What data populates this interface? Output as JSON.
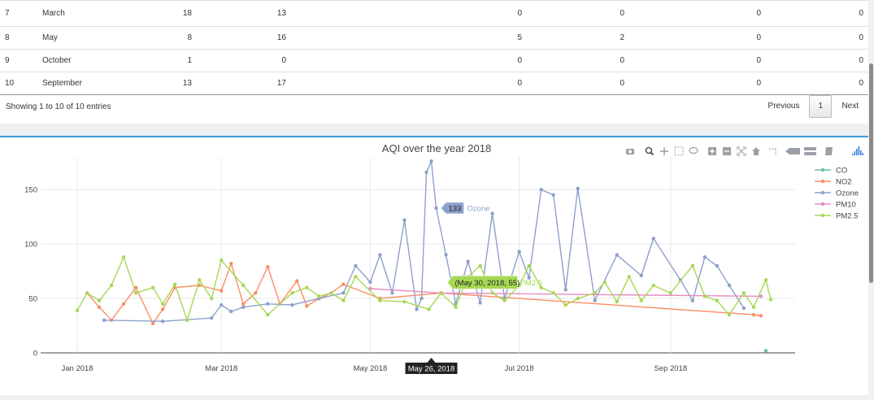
{
  "table": {
    "rows": [
      [
        "7",
        "March",
        "18",
        "13",
        "0",
        "0",
        "0",
        "0"
      ],
      [
        "8",
        "May",
        "8",
        "16",
        "5",
        "2",
        "0",
        "0"
      ],
      [
        "9",
        "October",
        "1",
        "0",
        "0",
        "0",
        "0",
        "0"
      ],
      [
        "10",
        "September",
        "13",
        "17",
        "0",
        "0",
        "0",
        "0"
      ]
    ],
    "info": "Showing 1 to 10 of 10 entries",
    "pagination": {
      "previous": "Previous",
      "current": "1",
      "next": "Next"
    }
  },
  "chart_data": {
    "type": "line",
    "title": "AQI over the year 2018",
    "x_ticks": [
      "Jan 2018",
      "Mar 2018",
      "May 2018",
      "Jul 2018",
      "Sep 2018"
    ],
    "y_ticks": [
      0,
      50,
      100,
      150
    ],
    "ylim": [
      0,
      180
    ],
    "xlim": [
      "2017-12-17",
      "2018-10-22"
    ],
    "grid": true,
    "legend": "right",
    "series": [
      {
        "name": "CO",
        "color": "#66c2a5",
        "x": [
          "2018-10-10"
        ],
        "y": [
          2
        ]
      },
      {
        "name": "NO2",
        "color": "#fc8d62",
        "x": [
          "2018-01-05",
          "2018-01-10",
          "2018-01-15",
          "2018-01-20",
          "2018-01-25",
          "2018-02-01",
          "2018-02-05",
          "2018-02-10",
          "2018-02-20",
          "2018-03-01",
          "2018-03-05",
          "2018-03-10",
          "2018-03-15",
          "2018-03-20",
          "2018-03-25",
          "2018-04-01",
          "2018-04-05",
          "2018-04-10",
          "2018-04-15",
          "2018-04-20",
          "2018-05-05",
          "2018-05-30",
          "2018-10-05",
          "2018-10-08"
        ],
        "y": [
          55,
          42,
          30,
          45,
          60,
          27,
          40,
          60,
          62,
          57,
          82,
          45,
          55,
          79,
          45,
          66,
          43,
          50,
          55,
          63,
          50,
          55,
          35,
          34
        ]
      },
      {
        "name": "Ozone",
        "color": "#8da0cb",
        "x": [
          "2018-01-12",
          "2018-02-05",
          "2018-02-25",
          "2018-03-01",
          "2018-03-05",
          "2018-03-10",
          "2018-03-20",
          "2018-03-30",
          "2018-04-10",
          "2018-04-20",
          "2018-04-25",
          "2018-05-01",
          "2018-05-05",
          "2018-05-10",
          "2018-05-15",
          "2018-05-20",
          "2018-05-22",
          "2018-05-24",
          "2018-05-26",
          "2018-05-28",
          "2018-06-01",
          "2018-06-05",
          "2018-06-10",
          "2018-06-15",
          "2018-06-20",
          "2018-06-25",
          "2018-07-01",
          "2018-07-05",
          "2018-07-10",
          "2018-07-15",
          "2018-07-20",
          "2018-07-25",
          "2018-08-01",
          "2018-08-10",
          "2018-08-20",
          "2018-08-25",
          "2018-09-05",
          "2018-09-10",
          "2018-09-15",
          "2018-09-20",
          "2018-09-25",
          "2018-10-01"
        ],
        "y": [
          30,
          29,
          32,
          44,
          38,
          42,
          45,
          44,
          50,
          55,
          80,
          65,
          90,
          55,
          122,
          40,
          50,
          166,
          176,
          133,
          90,
          45,
          84,
          46,
          128,
          50,
          93,
          69,
          150,
          145,
          58,
          151,
          48,
          90,
          71,
          105,
          67,
          48,
          88,
          80,
          62,
          41
        ]
      },
      {
        "name": "PM10",
        "color": "#e78ac3",
        "x": [
          "2018-05-01",
          "2018-05-30",
          "2018-10-08"
        ],
        "y": [
          59,
          55,
          52
        ]
      },
      {
        "name": "PM2.5",
        "color": "#a6d854",
        "x": [
          "2018-01-01",
          "2018-01-05",
          "2018-01-10",
          "2018-01-15",
          "2018-01-20",
          "2018-01-25",
          "2018-02-01",
          "2018-02-05",
          "2018-02-10",
          "2018-02-15",
          "2018-02-20",
          "2018-02-25",
          "2018-03-01",
          "2018-03-10",
          "2018-03-20",
          "2018-03-30",
          "2018-04-05",
          "2018-04-10",
          "2018-04-15",
          "2018-04-20",
          "2018-04-25",
          "2018-05-05",
          "2018-05-15",
          "2018-05-25",
          "2018-05-30",
          "2018-06-05",
          "2018-06-10",
          "2018-06-15",
          "2018-06-20",
          "2018-06-25",
          "2018-07-01",
          "2018-07-05",
          "2018-07-10",
          "2018-07-15",
          "2018-07-20",
          "2018-07-25",
          "2018-08-01",
          "2018-08-05",
          "2018-08-10",
          "2018-08-15",
          "2018-08-20",
          "2018-08-25",
          "2018-09-01",
          "2018-09-10",
          "2018-09-15",
          "2018-09-20",
          "2018-09-25",
          "2018-10-01",
          "2018-10-05",
          "2018-10-10",
          "2018-10-12"
        ],
        "y": [
          39,
          55,
          48,
          62,
          88,
          55,
          60,
          45,
          63,
          30,
          67,
          50,
          85,
          62,
          35,
          55,
          60,
          52,
          55,
          48,
          70,
          48,
          47,
          40,
          55,
          42,
          70,
          80,
          55,
          48,
          62,
          80,
          60,
          55,
          44,
          50,
          55,
          65,
          47,
          70,
          48,
          62,
          55,
          80,
          52,
          48,
          35,
          55,
          42,
          67,
          49
        ]
      }
    ],
    "tooltips": [
      {
        "text": "133",
        "series": "Ozone",
        "x": "2018-05-28",
        "y": 133
      },
      {
        "text": "(May 30, 2018, 55)",
        "series": "PM2.5",
        "x": "2018-05-30",
        "y": 55
      }
    ],
    "hover_x_label": "May 26, 2018"
  },
  "toolbar_icons": [
    "camera-icon",
    "zoom-icon",
    "pan-icon",
    "box-select-icon",
    "lasso-icon",
    "zoom-in-icon",
    "zoom-out-icon",
    "autoscale-icon",
    "reset-axes-icon",
    "spike-lines-icon",
    "hover-closest-icon",
    "hover-compare-icon",
    "edit-chart-icon",
    "plotly-logo-icon"
  ]
}
